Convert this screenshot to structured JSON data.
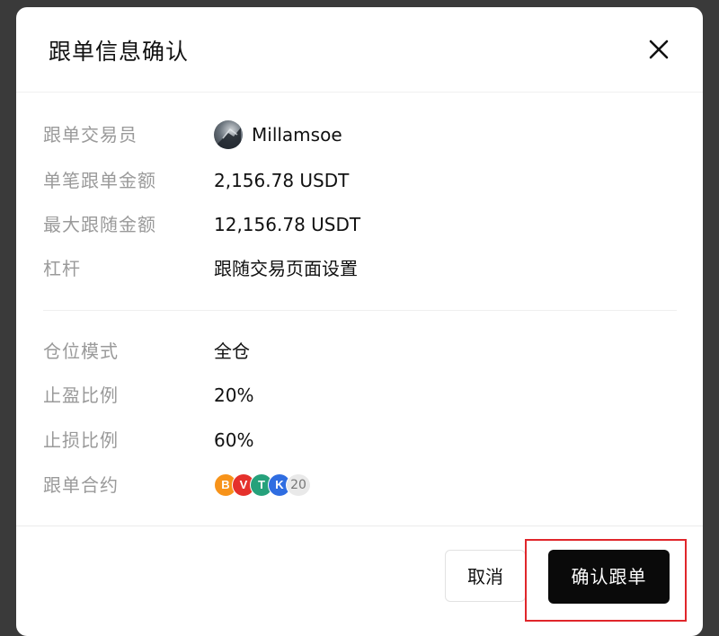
{
  "dialog": {
    "title": "跟单信息确认",
    "close_icon": "close-icon"
  },
  "info": {
    "trader": {
      "label": "跟单交易员",
      "value": "Millamsoe",
      "avatar_icon": "trader-avatar"
    },
    "single_amount": {
      "label": "单笔跟单金额",
      "value": "2,156.78 USDT"
    },
    "max_amount": {
      "label": "最大跟随金额",
      "value": "12,156.78 USDT"
    },
    "leverage": {
      "label": "杠杆",
      "value": "跟随交易页面设置"
    }
  },
  "settings": {
    "position_mode": {
      "label": "仓位模式",
      "value": "全仓"
    },
    "take_profit": {
      "label": "止盈比例",
      "value": "20%"
    },
    "stop_loss": {
      "label": "止损比例",
      "value": "60%"
    },
    "contracts": {
      "label": "跟单合约",
      "coins": [
        {
          "icon": "bitcoin-icon",
          "symbol": "B",
          "color": "#f7931a"
        },
        {
          "icon": "tron-icon",
          "symbol": "V",
          "color": "#e5312c"
        },
        {
          "icon": "tether-icon",
          "symbol": "T",
          "color": "#26a17b"
        },
        {
          "icon": "k-token-icon",
          "symbol": "K",
          "color": "#2f6de1"
        }
      ],
      "count": "20"
    }
  },
  "footer": {
    "cancel_label": "取消",
    "confirm_label": "确认跟单",
    "highlight_color": "#e0262b"
  }
}
